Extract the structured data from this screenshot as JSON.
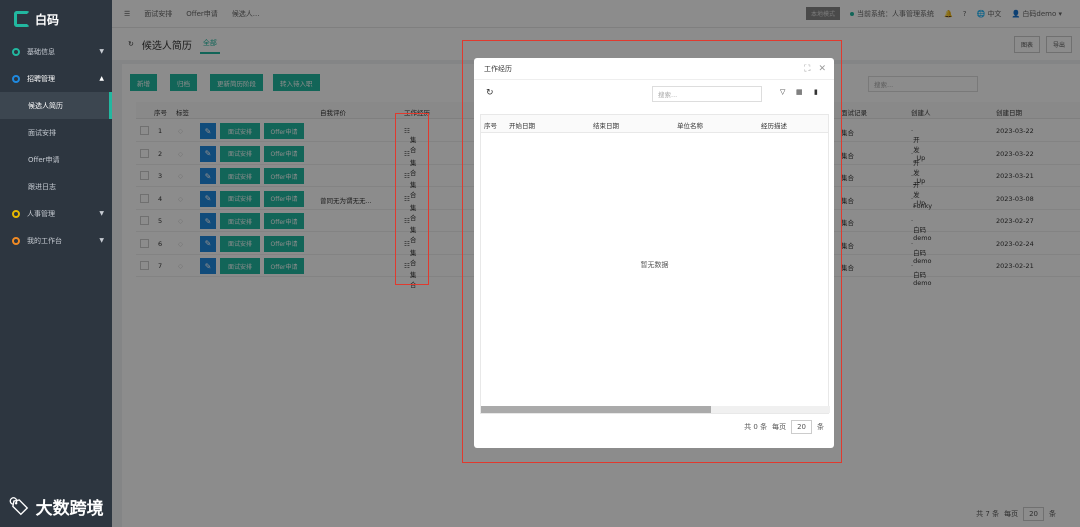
{
  "app": {
    "title": "白码"
  },
  "sidebar": {
    "items": [
      {
        "label": "基础信息"
      },
      {
        "label": "招聘管理"
      },
      {
        "label": "人事管理"
      },
      {
        "label": "我的工作台"
      }
    ],
    "sub": [
      {
        "label": "候选人简历"
      },
      {
        "label": "面试安排"
      },
      {
        "label": "Offer申请"
      },
      {
        "label": "跟进日志"
      }
    ]
  },
  "topbar": {
    "crumbs": [
      "面试安排",
      "Offer申请",
      "候选人..."
    ],
    "badge": "本地模式",
    "system": "当前系统：人事管理系统",
    "lang": "中文",
    "user": "白码demo"
  },
  "page": {
    "title": "候选人简历",
    "tab": "全部",
    "chart_btn": "图表",
    "export_btn": "导出"
  },
  "actions": [
    "新增",
    "归档",
    "更新简历阶段",
    "转入待入职"
  ],
  "search": {
    "placeholder": "搜索..."
  },
  "table": {
    "headers": [
      "序号",
      "标签",
      "自我评价",
      "工作经历",
      "面试记录",
      "创建人",
      "创建日期"
    ],
    "rows": [
      {
        "no": "1",
        "eval": "",
        "work": "集合",
        "rec": "集合",
        "creator": "开发_Up",
        "date": "2023-03-22"
      },
      {
        "no": "2",
        "eval": "",
        "work": "集合",
        "rec": "集合",
        "creator": "开发_Up",
        "date": "2023-03-22"
      },
      {
        "no": "3",
        "eval": "",
        "work": "集合",
        "rec": "集合",
        "creator": "开发_Up",
        "date": "2023-03-21"
      },
      {
        "no": "4",
        "eval": "曾同无为谓无无...",
        "work": "集合",
        "rec": "集合",
        "creator": "Fonky",
        "date": "2023-03-08"
      },
      {
        "no": "5",
        "eval": "",
        "work": "集合",
        "rec": "集合",
        "creator": "白码demo",
        "date": "2023-02-27"
      },
      {
        "no": "6",
        "eval": "",
        "work": "集合",
        "rec": "集合",
        "creator": "白码demo",
        "date": "2023-02-24"
      },
      {
        "no": "7",
        "eval": "",
        "work": "集合",
        "rec": "集合",
        "creator": "白码demo",
        "date": "2023-02-21"
      }
    ],
    "row_btn_interview": "面试安排",
    "row_btn_offer": "Offer申请",
    "footer": {
      "total": "共 7 条",
      "per": "每页",
      "size": "20",
      "unit": "条"
    }
  },
  "modal": {
    "title": "工作经历",
    "search": "搜索...",
    "headers": [
      "序号",
      "开始日期",
      "结束日期",
      "单位名称",
      "经历描述"
    ],
    "empty": "暂无数据",
    "footer": {
      "total": "共 0 条",
      "per": "每页",
      "size": "20",
      "unit": "条"
    }
  },
  "watermark": "大数跨境",
  "colors": {
    "accent": "#22b8a0",
    "sidebar": "#2d3640",
    "highlight": "#e03a2e"
  }
}
